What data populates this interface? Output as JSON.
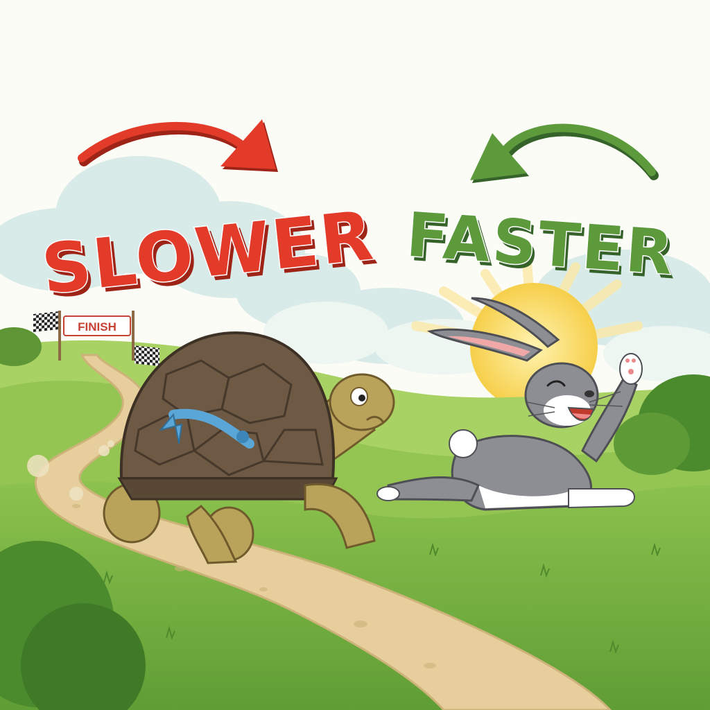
{
  "labels": {
    "slower": "SLOWER",
    "faster": "FASTER",
    "finish": "FINISH"
  },
  "colors": {
    "slower_red": "#e23b2a",
    "slower_shadow": "#9e2418",
    "faster_green": "#5c9a3c",
    "faster_shadow": "#35632a",
    "grass_light": "#9ccb5a",
    "grass_dark": "#6aa63a",
    "path": "#e6cf9c",
    "sky": "#fbfcf6",
    "sun": "#f6cf4a",
    "tortoise_shell": "#6e5a44",
    "tortoise_skin": "#b9a25a",
    "rabbit_fur": "#8d8e94",
    "scarf": "#5aa6d6"
  },
  "icons": {
    "red_arrow": "curved-arrow-right-icon",
    "green_arrow": "curved-arrow-left-icon",
    "finish_flags": "checkered-flag-icon"
  }
}
